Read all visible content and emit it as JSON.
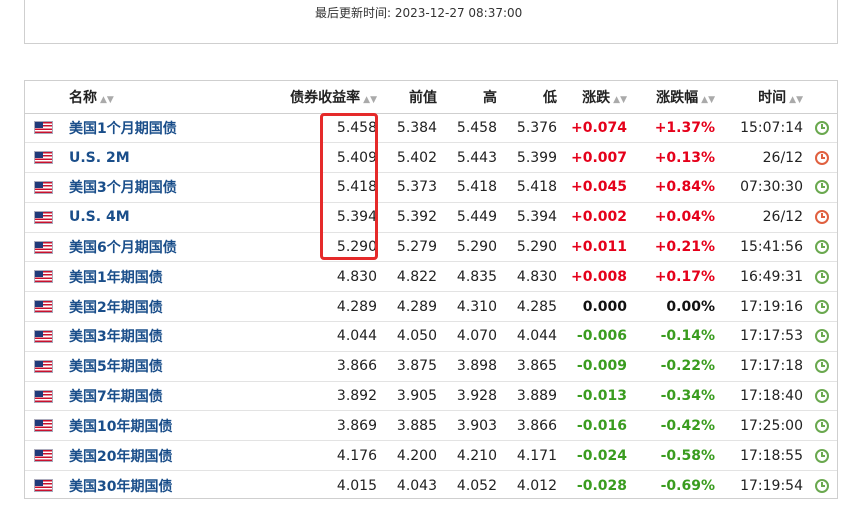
{
  "header": {
    "last_updated": "最后更新时间: 2023-12-27 08:37:00"
  },
  "table": {
    "columns": {
      "name": "名称",
      "yield": "债券收益率",
      "prev": "前值",
      "high": "高",
      "low": "低",
      "change": "涨跌",
      "change_pct": "涨跌幅",
      "time": "时间"
    },
    "rows": [
      {
        "name": "美国1个月期国债",
        "yield": "5.458",
        "prev": "5.384",
        "high": "5.458",
        "low": "5.376",
        "change": "+0.074",
        "change_pct": "+1.37%",
        "time": "15:07:14",
        "dir": "pos",
        "status": "open"
      },
      {
        "name": "U.S. 2M",
        "yield": "5.409",
        "prev": "5.402",
        "high": "5.443",
        "low": "5.399",
        "change": "+0.007",
        "change_pct": "+0.13%",
        "time": "26/12",
        "dir": "pos",
        "status": "closed"
      },
      {
        "name": "美国3个月期国债",
        "yield": "5.418",
        "prev": "5.373",
        "high": "5.418",
        "low": "5.418",
        "change": "+0.045",
        "change_pct": "+0.84%",
        "time": "07:30:30",
        "dir": "pos",
        "status": "open"
      },
      {
        "name": "U.S. 4M",
        "yield": "5.394",
        "prev": "5.392",
        "high": "5.449",
        "low": "5.394",
        "change": "+0.002",
        "change_pct": "+0.04%",
        "time": "26/12",
        "dir": "pos",
        "status": "closed"
      },
      {
        "name": "美国6个月期国债",
        "yield": "5.290",
        "prev": "5.279",
        "high": "5.290",
        "low": "5.290",
        "change": "+0.011",
        "change_pct": "+0.21%",
        "time": "15:41:56",
        "dir": "pos",
        "status": "open"
      },
      {
        "name": "美国1年期国债",
        "yield": "4.830",
        "prev": "4.822",
        "high": "4.835",
        "low": "4.830",
        "change": "+0.008",
        "change_pct": "+0.17%",
        "time": "16:49:31",
        "dir": "pos",
        "status": "open"
      },
      {
        "name": "美国2年期国债",
        "yield": "4.289",
        "prev": "4.289",
        "high": "4.310",
        "low": "4.285",
        "change": "0.000",
        "change_pct": "0.00%",
        "time": "17:19:16",
        "dir": "zero",
        "status": "open"
      },
      {
        "name": "美国3年期国债",
        "yield": "4.044",
        "prev": "4.050",
        "high": "4.070",
        "low": "4.044",
        "change": "-0.006",
        "change_pct": "-0.14%",
        "time": "17:17:53",
        "dir": "neg",
        "status": "open"
      },
      {
        "name": "美国5年期国债",
        "yield": "3.866",
        "prev": "3.875",
        "high": "3.898",
        "low": "3.865",
        "change": "-0.009",
        "change_pct": "-0.22%",
        "time": "17:17:18",
        "dir": "neg",
        "status": "open"
      },
      {
        "name": "美国7年期国债",
        "yield": "3.892",
        "prev": "3.905",
        "high": "3.928",
        "low": "3.889",
        "change": "-0.013",
        "change_pct": "-0.34%",
        "time": "17:18:40",
        "dir": "neg",
        "status": "open"
      },
      {
        "name": "美国10年期国债",
        "yield": "3.869",
        "prev": "3.885",
        "high": "3.903",
        "low": "3.866",
        "change": "-0.016",
        "change_pct": "-0.42%",
        "time": "17:25:00",
        "dir": "neg",
        "status": "open"
      },
      {
        "name": "美国20年期国债",
        "yield": "4.176",
        "prev": "4.200",
        "high": "4.210",
        "low": "4.171",
        "change": "-0.024",
        "change_pct": "-0.58%",
        "time": "17:18:55",
        "dir": "neg",
        "status": "open"
      },
      {
        "name": "美国30年期国债",
        "yield": "4.015",
        "prev": "4.043",
        "high": "4.052",
        "low": "4.012",
        "change": "-0.028",
        "change_pct": "-0.69%",
        "time": "17:19:54",
        "dir": "neg",
        "status": "open"
      }
    ]
  },
  "colors": {
    "positive": "#e5001a",
    "negative": "#3a9c1f",
    "link": "#1a4e8a",
    "highlight_box": "#e52a2a"
  },
  "icons": {
    "flag": "us-flag-icon",
    "status_open": "clock-open-icon",
    "status_closed": "clock-closed-icon"
  }
}
